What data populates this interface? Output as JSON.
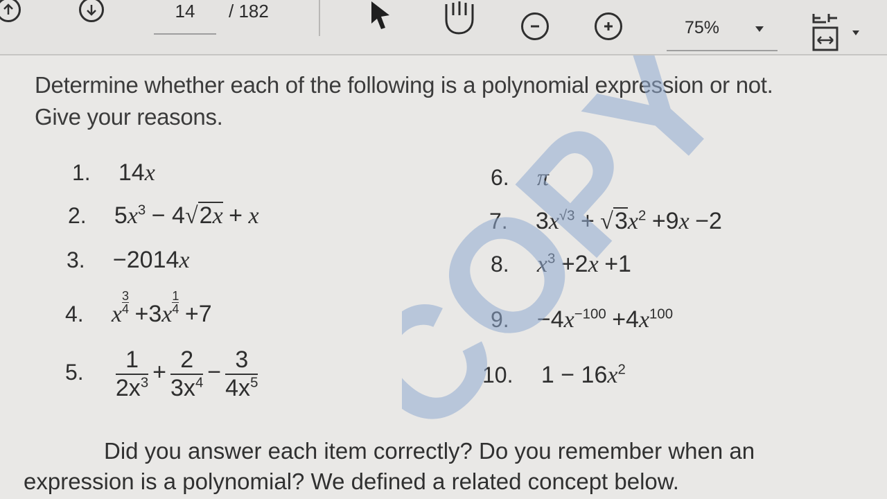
{
  "toolbar": {
    "page_current": "14",
    "page_total": "/ 182",
    "zoom": "75%",
    "icons": [
      "arrow-up-circle-icon",
      "arrow-down-circle-icon",
      "cursor-arrow-icon",
      "hand-tool-icon",
      "zoom-out-icon",
      "zoom-in-icon",
      "fit-page-icon"
    ]
  },
  "document": {
    "instruction_line1": "Determine whether each of the following is a polynomial expression or not.",
    "instruction_line2": "Give your reasons.",
    "items": [
      {
        "num": "1.",
        "text": "14x"
      },
      {
        "num": "2.",
        "text": "5x³ − 4√2x + x"
      },
      {
        "num": "3.",
        "text": "−2014x"
      },
      {
        "num": "4.",
        "text": "x^(3/4) + 3x^(1/4) + 7"
      },
      {
        "num": "5.",
        "text": "1/(2x³) + 2/(3x⁴) − 3/(4x⁵)"
      },
      {
        "num": "6.",
        "text": "π"
      },
      {
        "num": "7.",
        "text": "3x^√3 + √3x² + 9x − 2"
      },
      {
        "num": "8.",
        "text": "x³ + 2x + 1"
      },
      {
        "num": "9.",
        "text": "−4x^−100 + 4x^100"
      },
      {
        "num": "10.",
        "text": "1 − 16x²"
      }
    ],
    "footer_line1": "Did you answer each item correctly? Do you remember when an",
    "footer_line2": "expression is a polynomial? We defined a related concept below.",
    "watermark_text": "COPY"
  }
}
